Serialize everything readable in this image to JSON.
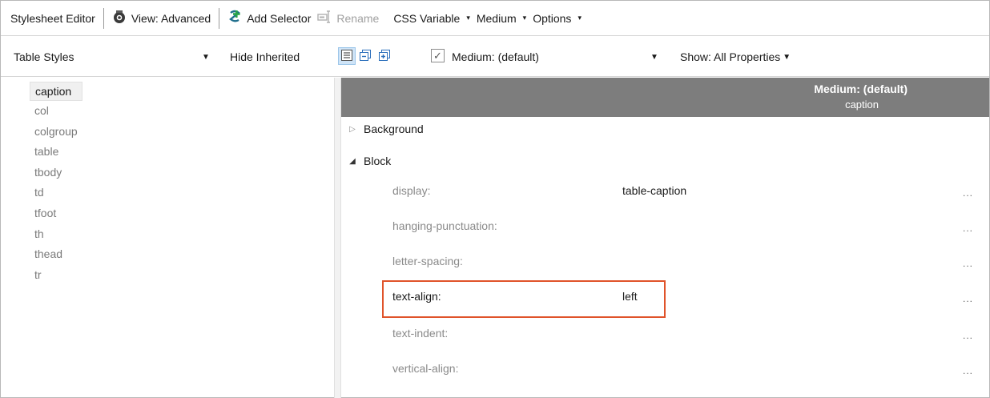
{
  "toolbar": {
    "title": "Stylesheet Editor",
    "view": "View: Advanced",
    "add_selector": "Add Selector",
    "rename": "Rename",
    "css_variable": "CSS Variable",
    "medium": "Medium",
    "options": "Options"
  },
  "toolbar2": {
    "selector_group": "Table Styles",
    "hide_inherited": "Hide Inherited",
    "medium_checked": true,
    "medium_value": "Medium: (default)",
    "show": "Show: All Properties"
  },
  "selectors": [
    {
      "label": "caption",
      "selected": true
    },
    {
      "label": "col",
      "selected": false
    },
    {
      "label": "colgroup",
      "selected": false
    },
    {
      "label": "table",
      "selected": false
    },
    {
      "label": "tbody",
      "selected": false
    },
    {
      "label": "td",
      "selected": false
    },
    {
      "label": "tfoot",
      "selected": false
    },
    {
      "label": "th",
      "selected": false
    },
    {
      "label": "thead",
      "selected": false
    },
    {
      "label": "tr",
      "selected": false
    }
  ],
  "header": {
    "medium": "Medium: (default)",
    "selector": "caption"
  },
  "groups": [
    {
      "label": "Background",
      "expanded": false
    },
    {
      "label": "Block",
      "expanded": true
    }
  ],
  "properties": [
    {
      "name": "display:",
      "value": "table-caption",
      "more": "...",
      "highlighted": false
    },
    {
      "name": "hanging-punctuation:",
      "value": "",
      "more": "...",
      "highlighted": false
    },
    {
      "name": "letter-spacing:",
      "value": "",
      "more": "...",
      "highlighted": false
    },
    {
      "name": "text-align:",
      "value": "left",
      "more": "...",
      "highlighted": true
    },
    {
      "name": "text-indent:",
      "value": "",
      "more": "...",
      "highlighted": false
    },
    {
      "name": "vertical-align:",
      "value": "",
      "more": "...",
      "highlighted": false
    }
  ],
  "colors": {
    "header_bg": "#7d7d7d",
    "highlight_border": "#e0532a",
    "active_button_bg": "#cfe4f7"
  },
  "icons": {
    "view": "eye-camera-icon",
    "add_selector": "add-selector-icon",
    "rename": "rename-icon",
    "show_default": "list-view-icon",
    "collapse_all": "collapse-all-icon",
    "expand_all": "expand-all-icon"
  }
}
